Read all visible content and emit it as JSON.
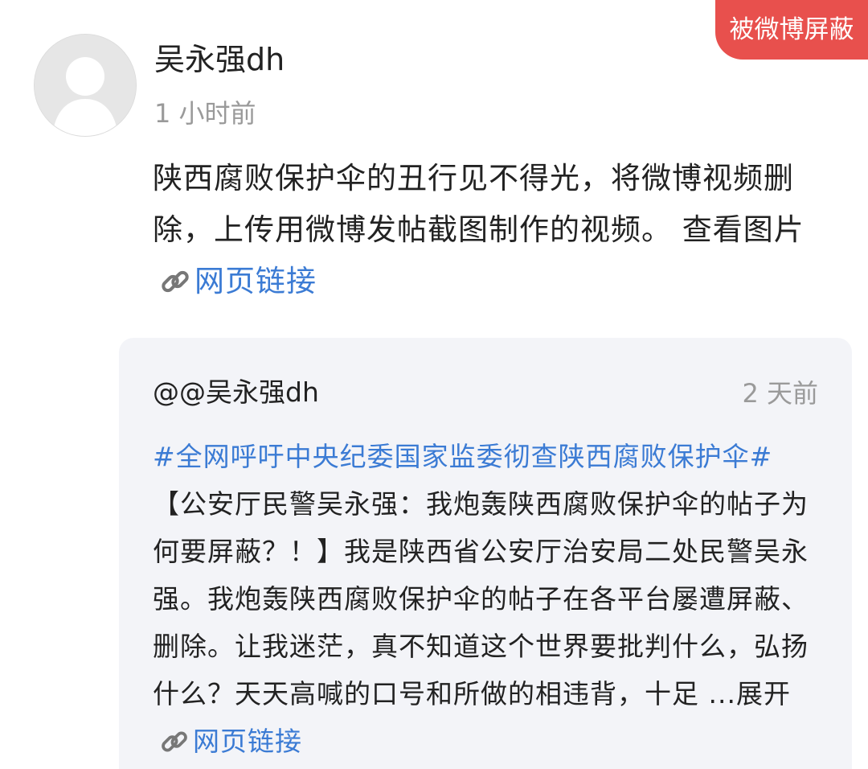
{
  "badge": {
    "label": "被微博屏蔽"
  },
  "post": {
    "author": "吴永强dh",
    "time": "1 小时前",
    "text": "陕西腐败保护伞的丑行见不得光，将微博视频删除，上传用微博发帖截图制作的视频。 查看图片",
    "link_icon": "link-icon",
    "link_label": "网页链接"
  },
  "quote": {
    "author": "@@吴永强dh",
    "time": "2 天前",
    "hashtag": "#全网呼吁中央纪委国家监委彻查陕西腐败保护伞#",
    "text": "【公安厅民警吴永强：我炮轰陕西腐败保护伞的帖子为何要屏蔽？！】我是陕西省公安厅治安局二处民警吴永强。我炮轰陕西腐败保护伞的帖子在各平台屡遭屏蔽、删除。让我迷茫，真不知道这个世界要批判什么，弘扬什么？天天高喊的口号和所做的相违背，十足 ...",
    "expand_label": "展开",
    "link_icon": "link-icon",
    "link_label": "网页链接"
  },
  "colors": {
    "badge_bg": "#e8504d",
    "link": "#3b7bd4",
    "muted": "#9a9a9a",
    "card_bg": "#f3f4f8"
  }
}
